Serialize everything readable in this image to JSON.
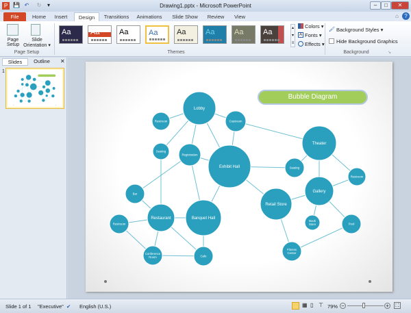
{
  "window": {
    "title": "Drawing1.pptx - Microsoft PowerPoint",
    "minimize": "–",
    "maximize": "□",
    "close": "✕"
  },
  "quick_access": {
    "save": "💾",
    "undo": "↶",
    "redo": "↻",
    "customize": "▾"
  },
  "tabs": [
    "File",
    "Home",
    "Insert",
    "Design",
    "Transitions",
    "Animations",
    "Slide Show",
    "Review",
    "View"
  ],
  "ribbon": {
    "page_setup": {
      "page_setup_label": "Page Setup",
      "orientation_label": "Slide Orientation ▾",
      "group": "Page Setup"
    },
    "themes": {
      "group": "Themes",
      "items": [
        {
          "label": "Aa",
          "bg": "#2b2a4a",
          "fg": "#fff"
        },
        {
          "label": "Aa",
          "bg": "#fff",
          "fg": "#fff",
          "band": "#d24726"
        },
        {
          "label": "Aa",
          "bg": "#fff",
          "fg": "#000"
        },
        {
          "label": "Aa",
          "bg": "#fff",
          "fg": "#3a6fb0"
        },
        {
          "label": "Aa",
          "bg": "#f3f0e2",
          "fg": "#222"
        },
        {
          "label": "Aa",
          "bg": "#1f7fa8",
          "fg": "#6dd3e8"
        },
        {
          "label": "Aa",
          "bg": "#777a66",
          "fg": "#e0dcc0"
        },
        {
          "label": "Aa",
          "bg": "#4a403c",
          "fg": "#fff",
          "band": "#c0504d"
        }
      ]
    },
    "colors": "Colors ▾",
    "fonts": "Fonts ▾",
    "effects": "Effects ▾",
    "background": {
      "group": "Background",
      "styles": "Background Styles ▾",
      "hide_graphics": "Hide Background Graphics",
      "hide_checked": false
    }
  },
  "pane": {
    "tabs": [
      "Slides",
      "Outline"
    ],
    "close": "✕",
    "slide_number": "1"
  },
  "slide": {
    "title": "Bubble Diagram",
    "accent": "#2aa0be",
    "title_bg": "#a2cd5a",
    "nodes": [
      "Lobby",
      "Restroom",
      "Coatroom",
      "Theater",
      "Seating",
      "Registration",
      "Exhibit Hall",
      "Seating",
      "Restroom",
      "Bar",
      "Gallery",
      "Retail Store",
      "Restaurant",
      "Banquet Hall",
      "Restroom",
      "Book Store",
      "Pool",
      "Fitness Center",
      "Conference Room",
      "Cafe"
    ],
    "edges": [
      [
        0,
        1
      ],
      [
        0,
        2
      ],
      [
        0,
        4
      ],
      [
        0,
        5
      ],
      [
        0,
        6
      ],
      [
        2,
        6
      ],
      [
        2,
        3
      ],
      [
        3,
        7
      ],
      [
        3,
        10
      ],
      [
        3,
        8
      ],
      [
        6,
        7
      ],
      [
        6,
        5
      ],
      [
        6,
        13
      ],
      [
        6,
        11
      ],
      [
        5,
        13
      ],
      [
        5,
        9
      ],
      [
        4,
        12
      ],
      [
        9,
        12
      ],
      [
        12,
        13
      ],
      [
        12,
        14
      ],
      [
        12,
        18
      ],
      [
        12,
        19
      ],
      [
        14,
        18
      ],
      [
        18,
        19
      ],
      [
        13,
        19
      ],
      [
        11,
        10
      ],
      [
        11,
        17
      ],
      [
        10,
        8
      ],
      [
        10,
        15
      ],
      [
        10,
        16
      ],
      [
        16,
        17
      ]
    ]
  },
  "status": {
    "slide": "Slide 1 of 1",
    "theme": "\"Executive\"",
    "language": "English (U.S.)",
    "zoom": "79%",
    "zoom_out": "−",
    "zoom_in": "+",
    "zoom_level": 0.45
  }
}
